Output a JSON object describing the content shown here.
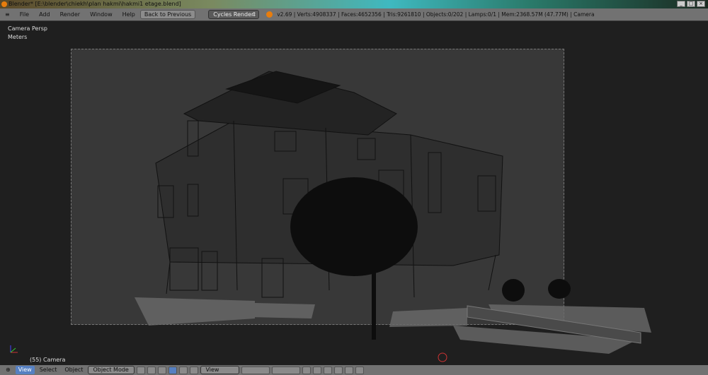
{
  "window": {
    "title": "Blender* [E:\\blender\\chiekh\\plan hakmi\\hakmi1 etage.blend]"
  },
  "menu": {
    "items": [
      "File",
      "Add",
      "Render",
      "Window",
      "Help"
    ],
    "back_button": "Back to Previous",
    "engine": "Cycles Render",
    "stats": "v2.69 | Verts:4908337 | Faces:4652356 | Tris:9261810 | Objects:0/202 | Lamps:0/1 | Mem:2368.57M (47.77M) | Camera"
  },
  "viewport": {
    "view_name": "Camera Persp",
    "units": "Meters",
    "object_info": "(55) Camera"
  },
  "footer": {
    "view": "View",
    "select": "Select",
    "object": "Object",
    "mode": "Object Mode",
    "orientation": "View"
  },
  "colors": {
    "accent": "#5680c2",
    "header": "#727272",
    "frame": "#383838"
  }
}
